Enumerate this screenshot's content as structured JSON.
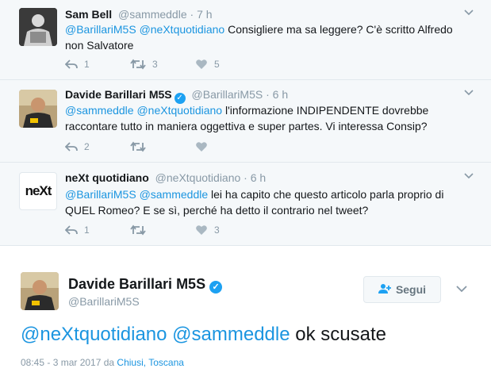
{
  "replies": [
    {
      "name": "Sam Bell",
      "handle": "@sammeddle",
      "dot": "·",
      "time": "7 h",
      "verified": false,
      "mentions": "@BarillariM5S @neXtquotidiano",
      "text": " Consigliere ma sa leggere? C'è scritto Alfredo non Salvatore",
      "reply_count": "1",
      "retweet_count": "3",
      "like_count": "5"
    },
    {
      "name": "Davide Barillari M5S",
      "handle": "@BarillariM5S",
      "dot": "·",
      "time": "6 h",
      "verified": true,
      "mentions": "@sammeddle @neXtquotidiano",
      "text": " l'informazione INDIPENDENTE dovrebbe raccontare tutto in maniera oggettiva e super partes. Vi interessa Consip?",
      "reply_count": "2",
      "retweet_count": "",
      "like_count": ""
    },
    {
      "name": "neXt quotidiano",
      "handle": "@neXtquotidiano",
      "dot": "·",
      "time": "6 h",
      "verified": false,
      "mentions": "@BarillariM5S @sammeddle",
      "text": " lei ha capito che questo articolo parla proprio di QUEL Romeo? E se sì, perché ha detto il contrario nel tweet?",
      "reply_count": "1",
      "retweet_count": "",
      "like_count": "3"
    }
  ],
  "avatar_logo_text": "neXt",
  "main": {
    "name": "Davide Barillari M5S",
    "handle": "@BarillariM5S",
    "follow_label": "Segui",
    "mentions": "@neXtquotidiano @sammeddle",
    "text": " ok scusate",
    "time": "08:45 - 3 mar 2017",
    "location_prefix": " da ",
    "location_city": "Chiusi",
    "location_sep": ", ",
    "location_region": "Toscana"
  },
  "colors": {
    "link": "#1b95e0",
    "verified": "#1da1f2",
    "muted": "#8899a6",
    "reply_bg": "#f5f8fa"
  },
  "icons": [
    "reply-icon",
    "retweet-icon",
    "like-icon",
    "caret-down-icon",
    "verified-icon",
    "add-user-icon"
  ]
}
